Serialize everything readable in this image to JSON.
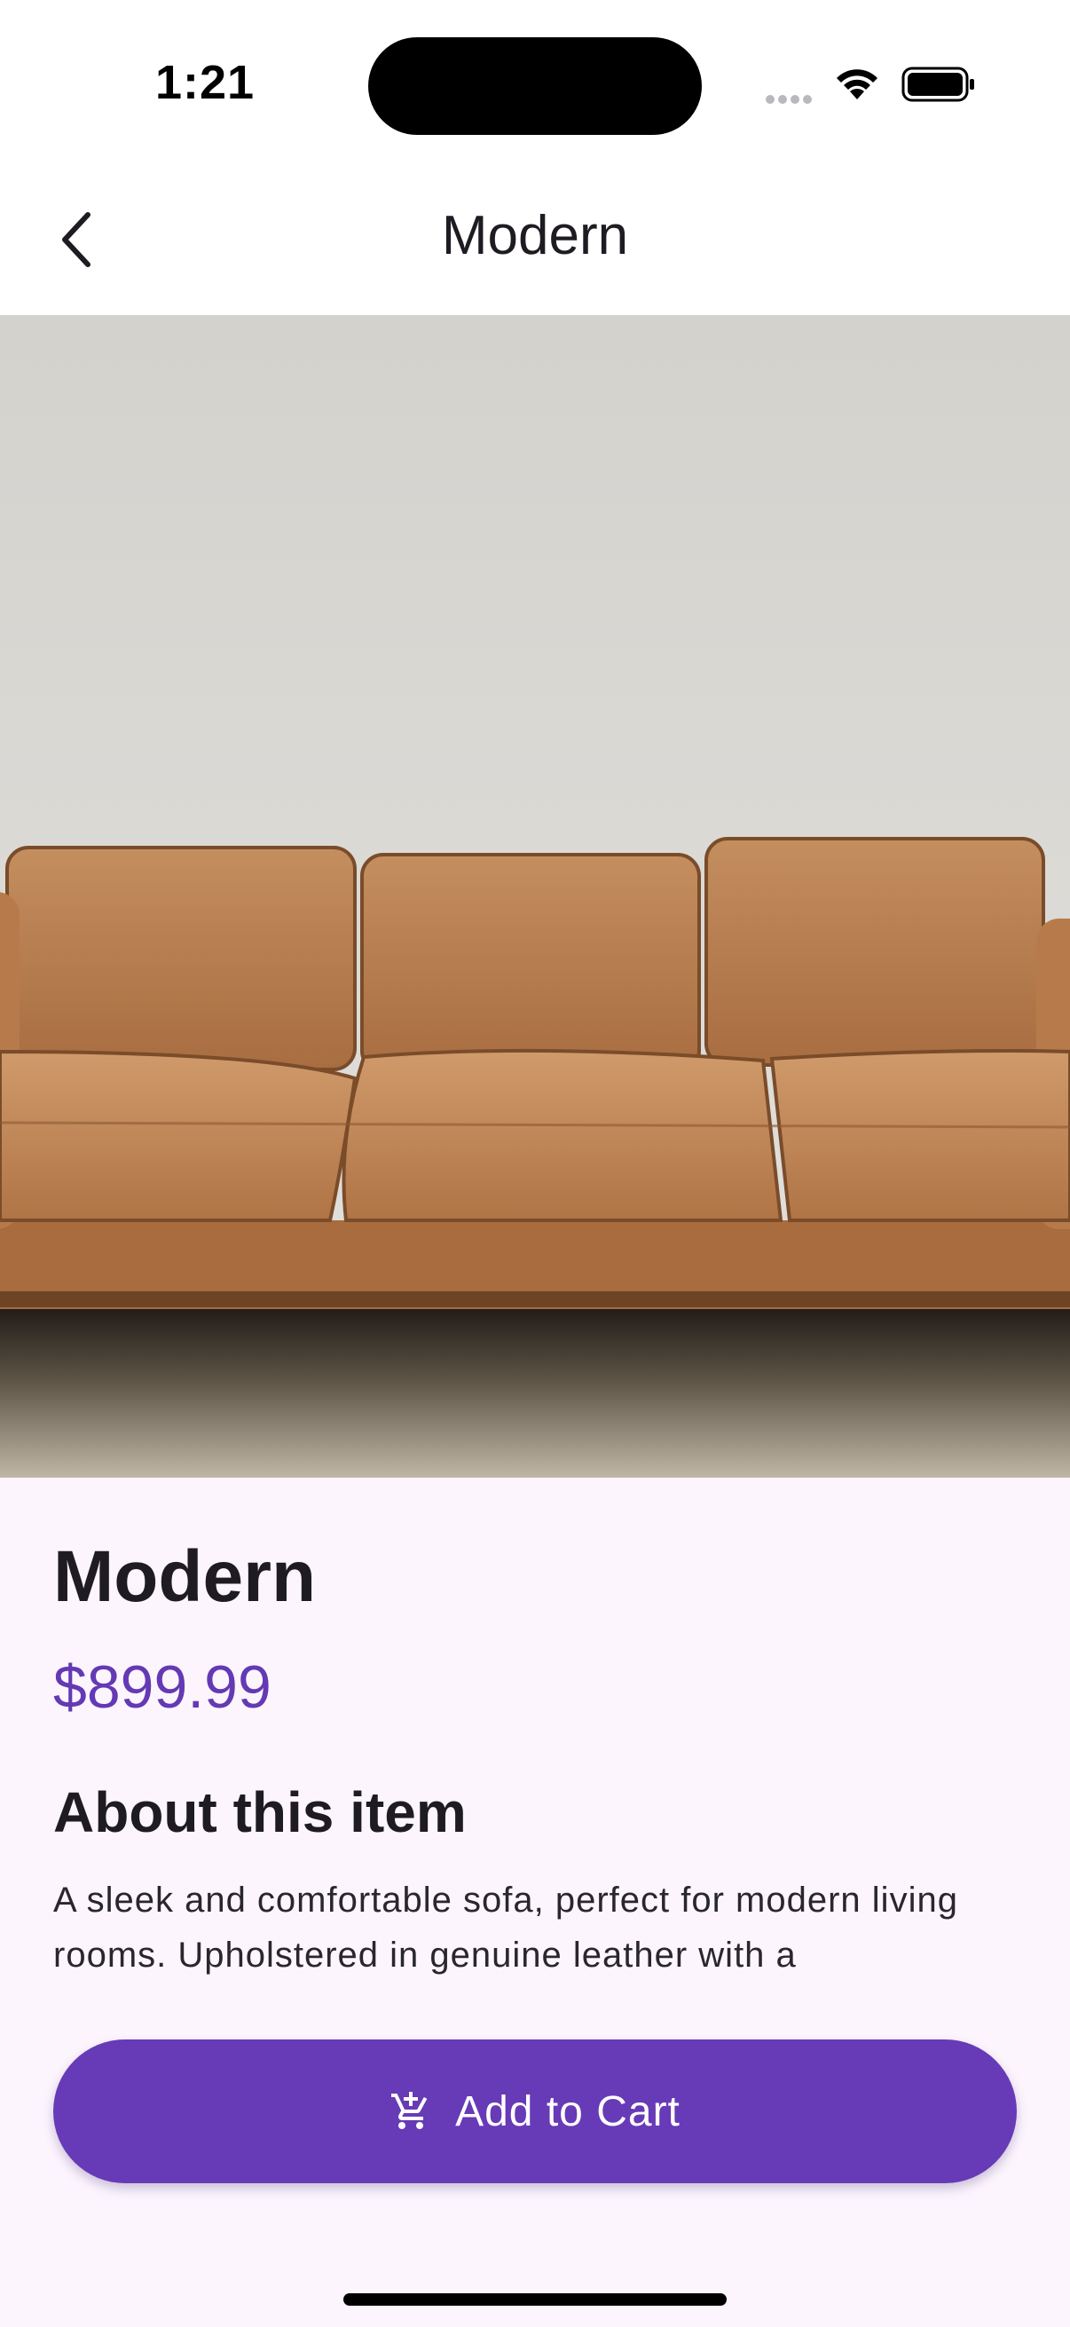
{
  "status_bar": {
    "time": "1:21",
    "icons": [
      "cellular-signal-icon",
      "wifi-icon",
      "battery-icon"
    ]
  },
  "nav": {
    "back_icon": "chevron-left-icon",
    "title": "Modern"
  },
  "product": {
    "image": "leather-sofa-photo",
    "title": "Modern",
    "price": "$899.99",
    "section_heading": "About this item",
    "description": "A sleek and comfortable sofa, perfect for modern living rooms. Upholstered in genuine leather with a"
  },
  "actions": {
    "cart_icon": "add-shopping-cart-icon",
    "add_to_cart_label": "Add to Cart"
  },
  "colors": {
    "accent": "#673ab7",
    "price": "#6439b4",
    "background": "#fcf5fd"
  }
}
